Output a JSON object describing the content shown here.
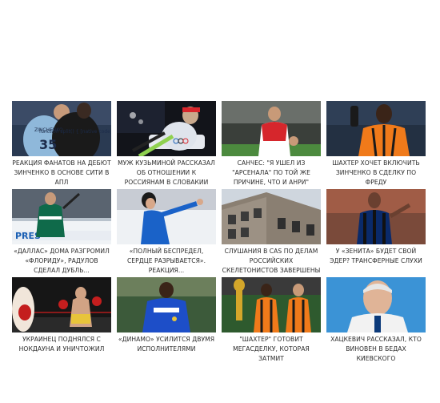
{
  "cards": [
    {
      "caption": "РЕАКЦИЯ ФАНАТОВ НА ДЕБЮТ ЗИНЧЕНКО В ОСНОВЕ СИТИ В АПЛ",
      "image": "football-players-hugging-photo",
      "jersey_text": "ZINCHENKO 35"
    },
    {
      "caption": "МУЖ КУЗЬМИНОЙ РАССКАЗАЛ ОБ ОТНОШЕНИИ К РОССИЯНАМ В СЛОВАКИИ",
      "image": "biathlete-racing-photo"
    },
    {
      "caption": "САНЧЕС: \"Я УШЕЛ ИЗ \"АРСЕНАЛА\" ПО ТОЙ ЖЕ ПРИЧИНЕ, ЧТО И АНРИ\"",
      "image": "arsenal-player-photo"
    },
    {
      "caption": "ШАХТЕР ХОЧЕТ ВКЛЮЧИТЬ ЗИНЧЕНКО В СДЕЛКУ ПО ФРЕДУ",
      "image": "shakhtar-player-photo"
    },
    {
      "caption": "«ДАЛЛАС» ДОМА РАЗГРОМИЛ «ФЛОРИДУ», РАДУЛОВ СДЕЛАЛ ДУБЛЬ...",
      "image": "hockey-player-celebrating-photo",
      "board_text": "PRES"
    },
    {
      "caption": "«ПОЛНЫЙ БЕСПРЕДЕЛ, СЕРДЦЕ РАЗРЫВАЕТСЯ». РЕАКЦИЯ...",
      "image": "figure-skater-photo"
    },
    {
      "caption": "СЛУШАНИЯ В CAS ПО ДЕЛАМ РОССИЙСКИХ СКЕЛЕТОНИСТОВ ЗАВЕРШЕНЫ",
      "image": "cas-building-photo"
    },
    {
      "caption": "У «ЗЕНИТА» БУДЕТ СВОЙ ЭДЕР? ТРАНСФЕРНЫЕ СЛУХИ",
      "image": "inter-player-photo"
    },
    {
      "caption": "УКРАИНЕЦ ПОДНЯЛСЯ С НОКДАУНА И УНИЧТОЖИЛ",
      "image": "boxing-match-photo"
    },
    {
      "caption": "«ДИНАМО» УСИЛИТСЯ ДВУМЯ ИСПОЛНИТЕЛЯМИ",
      "image": "blue-kit-player-photo"
    },
    {
      "caption": "\"ШАХТЕР\" ГОТОВИТ МЕГАСДЕЛКУ, КОТОРАЯ ЗАТМИТ",
      "image": "shakhtar-players-with-trophy-photo"
    },
    {
      "caption": "ХАЦКЕВИЧ РАССКАЗАЛ, КТО ВИНОВЕН В БЕДАХ КИЕВСКОГО",
      "image": "coach-portrait-photo"
    }
  ]
}
